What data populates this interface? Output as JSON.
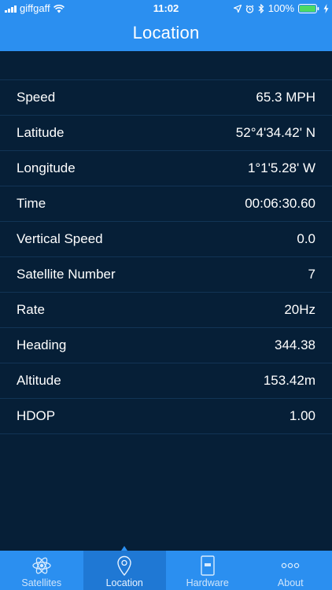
{
  "status_bar": {
    "carrier": "giffgaff",
    "time": "11:02",
    "battery": "100%"
  },
  "header": {
    "title": "Location"
  },
  "rows": [
    {
      "label": "Speed",
      "value": "65.3 MPH"
    },
    {
      "label": "Latitude",
      "value": "52°4'34.42' N"
    },
    {
      "label": "Longitude",
      "value": "1°1'5.28' W"
    },
    {
      "label": "Time",
      "value": "00:06:30.60"
    },
    {
      "label": "Vertical Speed",
      "value": "0.0"
    },
    {
      "label": "Satellite Number",
      "value": "7"
    },
    {
      "label": "Rate",
      "value": "20Hz"
    },
    {
      "label": "Heading",
      "value": "344.38"
    },
    {
      "label": "Altitude",
      "value": "153.42m"
    },
    {
      "label": "HDOP",
      "value": "1.00"
    }
  ],
  "tabs": [
    {
      "label": "Satellites",
      "icon": "atom-icon",
      "active": false
    },
    {
      "label": "Location",
      "icon": "map-pin-icon",
      "active": true
    },
    {
      "label": "Hardware",
      "icon": "device-icon",
      "active": false
    },
    {
      "label": "About",
      "icon": "more-dots-icon",
      "active": false
    }
  ],
  "colors": {
    "accent": "#2b8ff0",
    "background": "#061f37",
    "divider": "#123455"
  }
}
